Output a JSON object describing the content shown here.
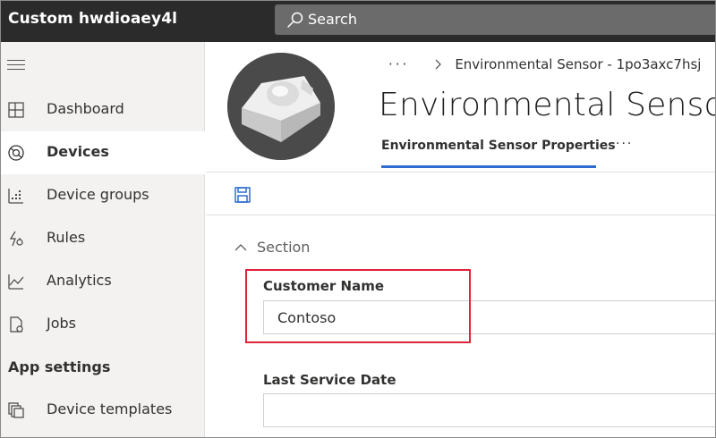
{
  "app": {
    "title": "Custom hwdioaey4l"
  },
  "search": {
    "label": "Search",
    "icon": "search-icon"
  },
  "sidebar": {
    "items": [
      {
        "label": "Dashboard",
        "icon": "dashboard-icon",
        "active": false
      },
      {
        "label": "Devices",
        "icon": "devices-icon",
        "active": true
      },
      {
        "label": "Device groups",
        "icon": "device-groups-icon",
        "active": false
      },
      {
        "label": "Rules",
        "icon": "rules-icon",
        "active": false
      },
      {
        "label": "Analytics",
        "icon": "analytics-icon",
        "active": false
      },
      {
        "label": "Jobs",
        "icon": "jobs-icon",
        "active": false
      }
    ],
    "section_heading": "App settings",
    "settings_items": [
      {
        "label": "Device templates",
        "icon": "device-templates-icon"
      }
    ]
  },
  "breadcrumb": {
    "more": "···",
    "current": "Environmental Sensor - 1po3axc7hsj"
  },
  "page": {
    "title": "Environmental Sensor",
    "tab_label": "Environmental Sensor Properties",
    "tab_more": "···"
  },
  "form": {
    "section_label": "Section",
    "fields": [
      {
        "label": "Customer Name",
        "value": "Contoso"
      },
      {
        "label": "Last Service Date",
        "value": ""
      }
    ]
  },
  "colors": {
    "topbar": "#2b2b2b",
    "search": "#6b6b6b",
    "accent": "#2f6bd0",
    "highlight": "#e0243a",
    "sidebar": "#f3f2f1"
  }
}
